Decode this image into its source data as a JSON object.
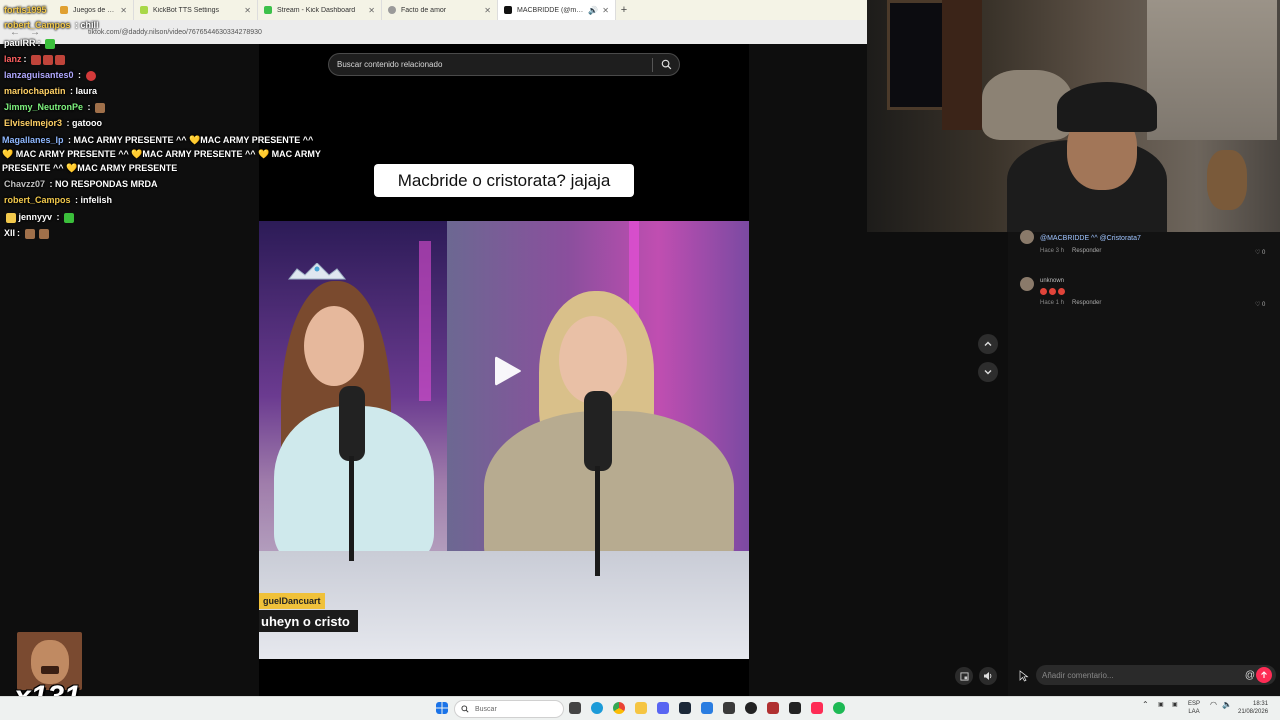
{
  "browser": {
    "tabs": [
      {
        "title": "Juegos de casino",
        "icon_color": "#e0a030",
        "active": false
      },
      {
        "title": "KickBot TTS Settings",
        "icon_color": "#a8d848",
        "active": false
      },
      {
        "title": "Stream - Kick Dashboard",
        "icon_color": "#3cc14a",
        "active": false
      },
      {
        "title": "Facto de amor",
        "icon_color": "#9a9a9a",
        "active": false
      },
      {
        "title": "MACBRIDDE (@macbrid",
        "icon_color": "#111111",
        "active": true
      }
    ],
    "new_tab": "+",
    "url": "tiktok.com/@daddy.nilson/video/7676544630334278930"
  },
  "chat": {
    "messages": [
      {
        "user": "fortis1995",
        "text": "",
        "user_color": "#f2c94c"
      },
      {
        "user": "robert_Campos",
        "text": "chill",
        "user_color": "#f2c94c"
      },
      {
        "user": "paulRR",
        "text": "",
        "user_color": "#ffffff"
      },
      {
        "user": "lanz",
        "text": "",
        "user_color": "#ff6060"
      },
      {
        "user": "lanzaguisantes0",
        "text": "",
        "user_color": "#b0a8ff"
      },
      {
        "user": "mariochapatin",
        "text": "laura",
        "user_color": "#ffd166"
      },
      {
        "user": "Jimmy_NeutronPe",
        "text": "",
        "user_color": "#7ef27e"
      },
      {
        "user": "Elviselmejor3",
        "text": "gatooo",
        "user_color": "#ffd166"
      },
      {
        "user": "Magallanes_lp",
        "text": "MAC ARMY PRESENTE ^^ 💛MAC ARMY PRESENTE ^^ 💛 MAC ARMY PRESENTE ^^ 💛MAC ARMY PRESENTE ^^ 💛 MAC ARMY PRESENTE ^^ 💛MAC ARMY PRESENTE",
        "user_color": "#8fb8ff"
      },
      {
        "user": "Chavzz07",
        "text": "NO RESPONDAS MRDA",
        "user_color": "#c0c0c0"
      },
      {
        "user": "robert_Campos",
        "text": "infelish",
        "user_color": "#f2c94c"
      },
      {
        "user": "jennyyv",
        "text": "",
        "user_color": "#ffffff"
      },
      {
        "user": "XII",
        "text": "",
        "user_color": "#ffffff"
      }
    ],
    "big_counter": "x131"
  },
  "video": {
    "search_placeholder": "Buscar contenido relacionado",
    "caption": "Macbride o cristorata? jajaja",
    "name_tag": "guelDancuart",
    "subtitle": "uheyn o cristo"
  },
  "comments": [
    {
      "author": "",
      "text": "@MACBRIDDE ^^ @Cristorata7",
      "time": "Hace 3 h",
      "reply": "Responder",
      "likes": "0"
    },
    {
      "author": "unknown",
      "text": "",
      "time": "Hace 1 h",
      "reply": "Responder",
      "likes": "0"
    }
  ],
  "add_comment": {
    "placeholder": "Añadir comentario...",
    "at": "@"
  },
  "taskbar": {
    "search": "Buscar",
    "lang_top": "ESP",
    "lang_bottom": "LAA",
    "time": "18:31",
    "date": "21/08/2026"
  },
  "colors": {
    "accent_tiktok": "#fe2c55",
    "highlight": "#f0c13a"
  }
}
